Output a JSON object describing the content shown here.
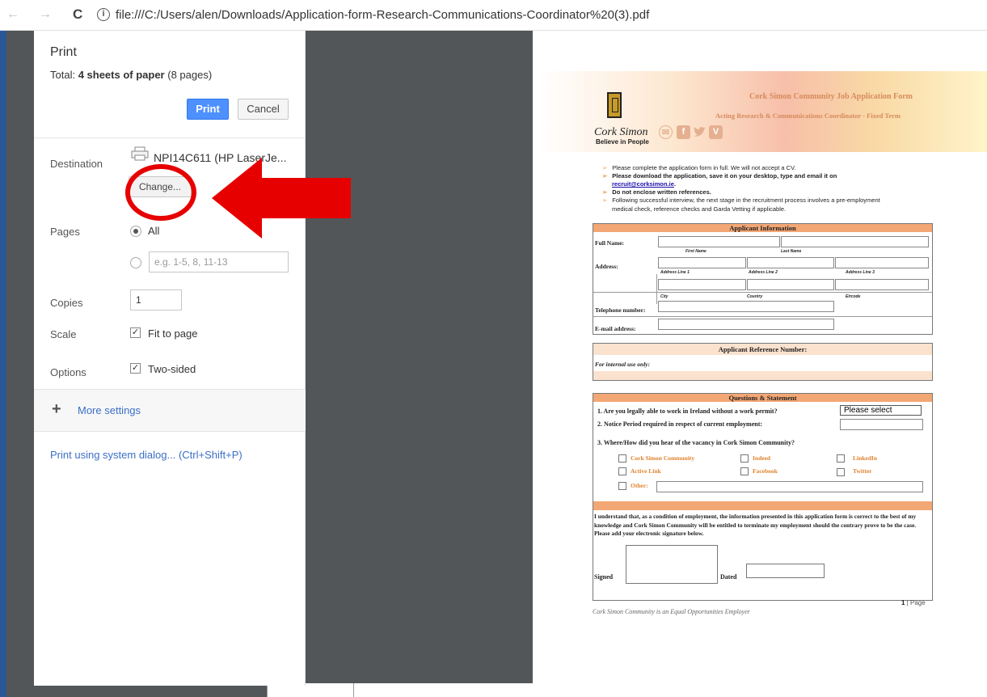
{
  "browser": {
    "back_glyph": "←",
    "forward_glyph": "→",
    "reload_glyph": "C",
    "info_glyph": "i",
    "url": "file:///C:/Users/alen/Downloads/Application-form-Research-Communications-Coordinator%20(3).pdf"
  },
  "print_dialog": {
    "title": "Print",
    "total_label": "Total: ",
    "total_value": "4 sheets of paper",
    "total_pages": " (8 pages)",
    "print_button": "Print",
    "cancel_button": "Cancel",
    "destination_label": "Destination",
    "destination_name": "NPI14C611 (HP LaserJe...",
    "change_button": "Change...",
    "pages_label": "Pages",
    "pages_all": "All",
    "pages_placeholder": "e.g. 1-5, 8, 11-13",
    "copies_label": "Copies",
    "copies_value": "1",
    "scale_label": "Scale",
    "fit_to_page": "Fit to page",
    "options_label": "Options",
    "two_sided": "Two-sided",
    "more_settings": "More settings",
    "plus_glyph": "+",
    "system_dialog": "Print using system dialog... (Ctrl+Shift+P)"
  },
  "document": {
    "form_title": "Cork Simon Community Job Application Form",
    "form_subtitle": "Acting Research & Communications Coordinator - Fixed Term",
    "logo_name": "Cork Simon",
    "logo_tagline": "Believe in People",
    "social": {
      "facebook": "f",
      "vimeo": "V"
    },
    "bullets": [
      "Please complete the application form in full. We will not accept a CV.",
      "Please download the application, save it on your desktop, type and email it on",
      "Do not enclose written references.",
      "Following successful interview, the next stage in the recruitment process involves a pre-employment"
    ],
    "email_link": "recruit@corksimon.ie",
    "email_suffix": ".",
    "bullet4_cont": "medical check, reference checks and Garda Vetting if applicable.",
    "applicant_info": {
      "heading": "Applicant Information",
      "full_name": "Full Name:",
      "first_name": "First Name",
      "last_name": "Last Name",
      "address": "Address:",
      "address_line_1": "Address Line 1",
      "address_line_2": "Address Line 2",
      "address_line_3": "Address Line 3",
      "city": "City",
      "country": "Country",
      "eircode": "Eircode",
      "telephone": "Telephone number:",
      "email": "E-mail address:"
    },
    "reference": {
      "heading": "Applicant Reference Number:",
      "internal": "For internal use only:"
    },
    "questions": {
      "heading": "Questions & Statement",
      "q1": "1.  Are you legally able to work in Ireland without a work permit?",
      "q1_select": "Please select",
      "q2": "2.  Notice Period required in respect of current employment:",
      "q3": "3.  Where/How did you hear of the vacancy in Cork Simon Community?",
      "options": [
        "Cork Simon Community",
        "Indeed",
        "LinkedIn",
        "Active Link",
        "Facebook",
        "Twitter",
        "Other:"
      ]
    },
    "statement": "I understand that, as a condition of employment, the information presented in this application form is correct to the best of my knowledge and Cork Simon Community will be entitled to terminate my employment should the contrary prove to be the case. Please add your electronic signature below.",
    "signed": "Signed",
    "dated": "Dated",
    "page_number": "1",
    "page_label": " | Page",
    "footer": "Cork Simon Community is an Equal Opportunities Employer"
  },
  "colors": {
    "accent_orange": "#f3a774",
    "print_blue": "#4d90fe",
    "annotation_red": "#e60000",
    "viewer_bg": "#525659"
  }
}
